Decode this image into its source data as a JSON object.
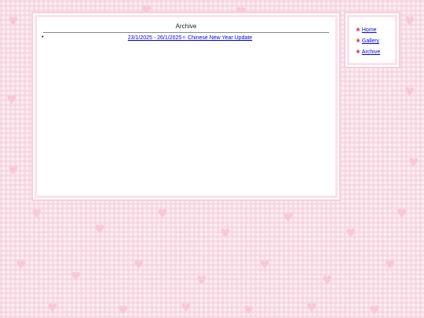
{
  "archive": {
    "title": "Archive",
    "entries": [
      {
        "label": "23/1/2025 - 26/1/2025✧ Chinese New Year Update"
      }
    ]
  },
  "nav": {
    "items": [
      {
        "label": "Home",
        "icon": "flower-icon"
      },
      {
        "label": "Gallery",
        "icon": "flower-icon"
      },
      {
        "label": "Archive",
        "icon": "flower-icon"
      }
    ]
  },
  "colors": {
    "background": "#fdf0f4",
    "heart": "#f7c9d8",
    "panel_border": "#f6cfdc",
    "link": "#0000ee",
    "flower": "#c03048"
  }
}
